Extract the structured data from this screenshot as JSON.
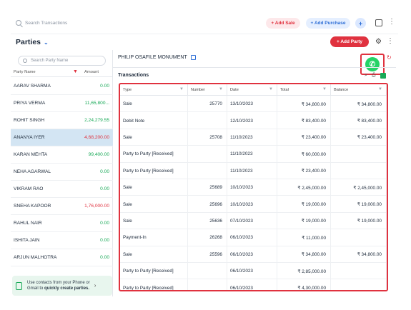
{
  "topbar": {
    "search_placeholder": "Search Transactions",
    "add_sale": "+ Add Sale",
    "add_purchase": "+ Add Purchase",
    "plus": "+",
    "more": "⋮"
  },
  "header": {
    "title": "Parties",
    "chevron": "⌄",
    "add_party": "+ Add Party",
    "gear": "⚙",
    "more": "⋮"
  },
  "sidebar": {
    "search_placeholder": "Search Party Name",
    "col_name": "Party Name",
    "col_amount": "Amount",
    "filter_icon": "▼",
    "parties": [
      {
        "name": "AARAV SHARMA",
        "amount": "0.00",
        "tone": "g"
      },
      {
        "name": "PRIYA VERMA",
        "amount": "11,65,800...",
        "tone": "g"
      },
      {
        "name": "ROHIT SINGH",
        "amount": "2,24,279.55",
        "tone": "g"
      },
      {
        "name": "ANANYA IYER",
        "amount": "4,68,200.00",
        "tone": "r"
      },
      {
        "name": "KARAN MEHTA",
        "amount": "99,400.00",
        "tone": "g"
      },
      {
        "name": "NEHA AGARWAL",
        "amount": "0.00",
        "tone": "g"
      },
      {
        "name": "VIKRAM RAO",
        "amount": "0.00",
        "tone": "g"
      },
      {
        "name": "SNEHA KAPOOR",
        "amount": "1,76,000.00",
        "tone": "r"
      },
      {
        "name": "RAHUL NAIR",
        "amount": "0.00",
        "tone": "g"
      },
      {
        "name": "ISHITA JAIN",
        "amount": "0.00",
        "tone": "g"
      },
      {
        "name": "ARJUN MALHOTRA",
        "amount": "0.00",
        "tone": "g"
      }
    ],
    "selected_index": 3,
    "banner_line1": "Use contacts from your Phone or",
    "banner_line2a": "Gmail to ",
    "banner_line2b": "quickly create parties.",
    "banner_arrow": "›"
  },
  "detail": {
    "party_name": "PHILIP OSAFILE MONUMENT",
    "transactions_title": "Transactions",
    "whatsapp_icon": "whatsapp-icon",
    "columns": [
      "Type",
      "Number",
      "Date",
      "Total",
      "Balance"
    ],
    "rows": [
      {
        "type": "Sale",
        "number": "25770",
        "date": "13/10/2023",
        "total": "₹ 34,800.00",
        "balance": "₹ 34,800.00"
      },
      {
        "type": "Debit Note",
        "number": "",
        "date": "12/10/2023",
        "total": "₹ 83,400.00",
        "balance": "₹ 83,400.00"
      },
      {
        "type": "Sale",
        "number": "25708",
        "date": "11/10/2023",
        "total": "₹ 23,400.00",
        "balance": "₹ 23,400.00"
      },
      {
        "type": "Party to Party [Received]",
        "number": "",
        "date": "11/10/2023",
        "total": "₹ 60,000.00",
        "balance": ""
      },
      {
        "type": "Party to Party [Received]",
        "number": "",
        "date": "11/10/2023",
        "total": "₹ 23,400.00",
        "balance": ""
      },
      {
        "type": "Sale",
        "number": "25689",
        "date": "10/10/2023",
        "total": "₹ 2,45,000.00",
        "balance": "₹ 2,45,000.00"
      },
      {
        "type": "Sale",
        "number": "25696",
        "date": "10/10/2023",
        "total": "₹ 19,000.00",
        "balance": "₹ 19,000.00"
      },
      {
        "type": "Sale",
        "number": "25636",
        "date": "07/10/2023",
        "total": "₹ 19,000.00",
        "balance": "₹ 19,000.00"
      },
      {
        "type": "Payment-In",
        "number": "26268",
        "date": "06/10/2023",
        "total": "₹ 11,000.00",
        "balance": ""
      },
      {
        "type": "Sale",
        "number": "25596",
        "date": "06/10/2023",
        "total": "₹ 34,800.00",
        "balance": "₹ 34,800.00"
      },
      {
        "type": "Party to Party [Received]",
        "number": "",
        "date": "06/10/2023",
        "total": "₹ 2,85,000.00",
        "balance": ""
      },
      {
        "type": "Party to Party [Received]",
        "number": "",
        "date": "06/10/2023",
        "total": "₹ 4,30,000.00",
        "balance": ""
      }
    ]
  },
  "colors": {
    "accent_red": "#e0323f",
    "accent_blue": "#2f6fd6",
    "positive_green": "#18a957",
    "selected_row": "#d3e5f3"
  }
}
